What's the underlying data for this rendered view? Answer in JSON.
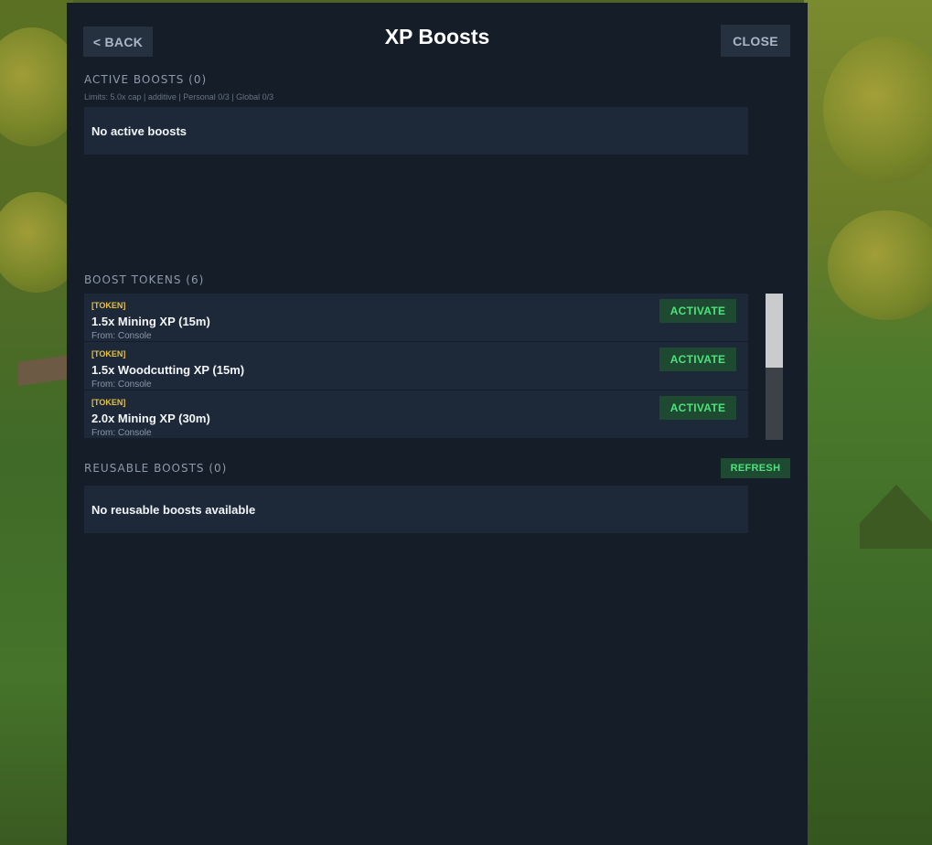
{
  "header": {
    "back_label": "< BACK",
    "title": "XP Boosts",
    "close_label": "CLOSE"
  },
  "active_boosts": {
    "label": "ACTIVE BOOSTS (0)",
    "limits": "Limits: 5.0x cap | additive | Personal 0/3 | Global 0/3",
    "empty_text": "No active boosts"
  },
  "boost_tokens": {
    "label": "BOOST TOKENS (6)",
    "activate_label": "ACTIVATE",
    "items": [
      {
        "tag": "[TOKEN]",
        "name": "1.5x Mining XP (15m)",
        "source": "From: Console"
      },
      {
        "tag": "[TOKEN]",
        "name": "1.5x Woodcutting XP (15m)",
        "source": "From: Console"
      },
      {
        "tag": "[TOKEN]",
        "name": "2.0x Mining XP (30m)",
        "source": "From: Console"
      }
    ],
    "scroll_position": 0
  },
  "reusable_boosts": {
    "label": "REUSABLE BOOSTS (0)",
    "refresh_label": "REFRESH",
    "empty_text": "No reusable boosts available"
  },
  "colors": {
    "panel_bg": "#151d28",
    "row_bg": "#1d2938",
    "accent_green": "#4ee27e",
    "token_tag": "#e6c043"
  }
}
